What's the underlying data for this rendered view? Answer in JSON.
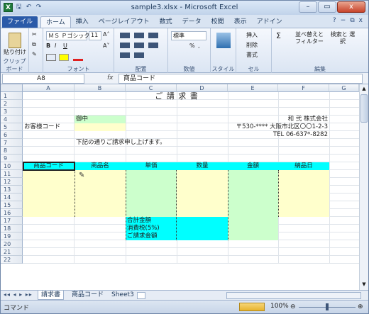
{
  "title": "sample3.xlsx - Microsoft Excel",
  "qat": {
    "app_icon": "X",
    "save": "🖫",
    "undo": "↶",
    "redo": "↷"
  },
  "window": {
    "minimize": "–",
    "restore": "▭",
    "close": "x"
  },
  "tabs": [
    "ファイル",
    "ホーム",
    "挿入",
    "ページレイアウト",
    "数式",
    "データ",
    "校閲",
    "表示",
    "アドイン"
  ],
  "tabs_right": {
    "help": "?",
    "min": "−",
    "restore": "⧉",
    "close": "x"
  },
  "ribbon": {
    "clipboard": {
      "label": "クリップボード",
      "paste": "貼り付け",
      "cut": "✂",
      "copy": "⧉",
      "fmt": "✎"
    },
    "font": {
      "label": "フォント",
      "name": "ＭＳ Ｐゴシック",
      "size": "11",
      "bold": "B",
      "italic": "I",
      "underline": "U",
      "grow": "A˄",
      "shrink": "A˅"
    },
    "align": {
      "label": "配置"
    },
    "number": {
      "label": "数値",
      "format": "標準",
      "percent": "%",
      "comma": ","
    },
    "style": {
      "label": "スタイル"
    },
    "cells": {
      "label": "セル",
      "insert": "挿入",
      "delete": "削除",
      "format": "書式"
    },
    "edit": {
      "label": "編集",
      "sort": "並べ替えと フィルター",
      "find": "検索と 選択",
      "sigma": "Σ"
    }
  },
  "namebox": "A8",
  "fx": "fx",
  "formula": "商品コード",
  "columns": [
    "A",
    "B",
    "C",
    "D",
    "E",
    "F",
    "G"
  ],
  "rows": [
    "1",
    "2",
    "3",
    "4",
    "5",
    "6",
    "7",
    "8",
    "9",
    "10",
    "11",
    "12",
    "13",
    "14",
    "15",
    "16",
    "17",
    "18",
    "19",
    "20",
    "21",
    "22"
  ],
  "cells": {
    "invoice_title": "ご 請 求 書",
    "honorific": "御中",
    "company": "和 弐 株式会社",
    "customer_code_label": "お客様コード",
    "address": "〒530-**** 大阪市北区〇〇1-2-3",
    "tel": "TEL  06-637*-8282",
    "message": "下記の通りご請求申し上げます。",
    "headers": [
      "商品コード",
      "商品名",
      "単価",
      "数量",
      "金額",
      "納品日"
    ],
    "subtotal": "合計金額",
    "tax": "消費税(5%)",
    "total": "ご請求金額"
  },
  "sheet_tabs": [
    "請求書",
    "商品コード",
    "Sheet3"
  ],
  "status": {
    "mode": "コマンド",
    "zoom": "100%"
  },
  "colors": {
    "cyan": "#00ffff",
    "green": "#ccffcc",
    "yellow": "#ffffcc"
  }
}
